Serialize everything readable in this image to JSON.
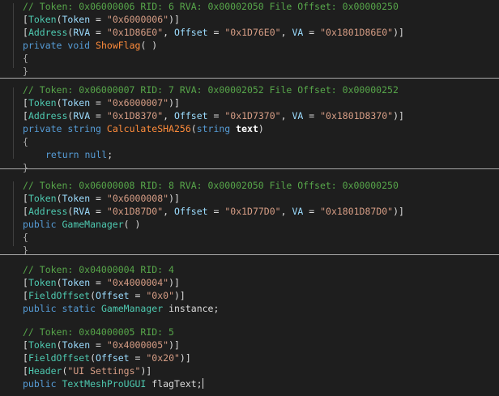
{
  "blocks": {
    "show_flag": {
      "comment": "// Token: 0x06000006 RID: 6 RVA: 0x00002050 File Offset: 0x00000250",
      "token_attr": "Token",
      "token_prop": "Token",
      "token_value": "\"0x6000006\"",
      "address_attr": "Address",
      "rva_prop": "RVA",
      "rva_value": "\"0x1D86E0\"",
      "offset_prop": "Offset",
      "offset_value": "\"0x1D76E0\"",
      "va_prop": "VA",
      "va_value": "\"0x1801D86E0\"",
      "modifier": "private",
      "return_type": "void",
      "method_name": "ShowFlag",
      "open_brace": "{",
      "close_brace": "}"
    },
    "calculate_sha256": {
      "comment": "// Token: 0x06000007 RID: 7 RVA: 0x00002052 File Offset: 0x00000252",
      "token_attr": "Token",
      "token_prop": "Token",
      "token_value": "\"0x6000007\"",
      "address_attr": "Address",
      "rva_prop": "RVA",
      "rva_value": "\"0x1D8370\"",
      "offset_prop": "Offset",
      "offset_value": "\"0x1D7370\"",
      "va_prop": "VA",
      "va_value": "\"0x1801D8370\"",
      "modifier": "private",
      "return_type": "string",
      "method_name": "CalculateSHA256",
      "param_type": "string",
      "param_name": "text",
      "open_brace": "{",
      "body_keyword": "return",
      "body_value": "null",
      "close_brace": "}"
    },
    "game_manager_ctor": {
      "comment": "// Token: 0x06000008 RID: 8 RVA: 0x00002050 File Offset: 0x00000250",
      "token_attr": "Token",
      "token_prop": "Token",
      "token_value": "\"0x6000008\"",
      "address_attr": "Address",
      "rva_prop": "RVA",
      "rva_value": "\"0x1D87D0\"",
      "offset_prop": "Offset",
      "offset_value": "\"0x1D77D0\"",
      "va_prop": "VA",
      "va_value": "\"0x1801D87D0\"",
      "modifier": "public",
      "method_name": "GameManager",
      "open_brace": "{",
      "close_brace": "}"
    },
    "instance_field": {
      "comment": "// Token: 0x04000004 RID: 4",
      "token_attr": "Token",
      "token_prop": "Token",
      "token_value": "\"0x4000004\"",
      "fieldoffset_attr": "FieldOffset",
      "offset_prop": "Offset",
      "offset_value": "\"0x0\"",
      "modifier": "public",
      "static_kw": "static",
      "field_type": "GameManager",
      "field_name": "instance"
    },
    "flag_text_field": {
      "comment": "// Token: 0x04000005 RID: 5",
      "token_attr": "Token",
      "token_prop": "Token",
      "token_value": "\"0x4000005\"",
      "fieldoffset_attr": "FieldOffset",
      "offset_prop": "Offset",
      "offset_value": "\"0x20\"",
      "header_attr": "Header",
      "header_value": "\"UI Settings\"",
      "modifier": "public",
      "field_type": "TextMeshProUGUI",
      "field_name": "flagText"
    }
  },
  "colors": {
    "background": "#1e1e1e",
    "comment": "#57a64a",
    "keyword": "#569cd6",
    "type": "#4ec9b0",
    "string": "#d69d85",
    "method": "#ff8c3b",
    "property": "#9cdcfe",
    "separator": "#a8a8a8"
  }
}
